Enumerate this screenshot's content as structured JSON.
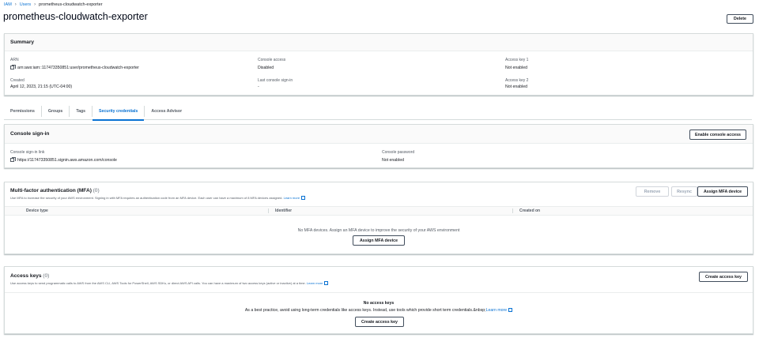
{
  "breadcrumb": {
    "root": "IAM",
    "users": "Users",
    "current": "prometheus-cloudwatch-exporter"
  },
  "page": {
    "title": "prometheus-cloudwatch-exporter",
    "delete_label": "Delete"
  },
  "summary": {
    "title": "Summary",
    "arn_label": "ARN",
    "arn_value": "arn:aws:iam::117473350851:user/prometheus-cloudwatch-exporter",
    "created_label": "Created",
    "created_value": "April 12, 2023, 21:15 (UTC-04:00)",
    "console_access_label": "Console access",
    "console_access_value": "Disabled",
    "last_signin_label": "Last console sign-in",
    "last_signin_value": "-",
    "access_key1_label": "Access key 1",
    "access_key1_value": "Not enabled",
    "access_key2_label": "Access key 2",
    "access_key2_value": "Not enabled"
  },
  "tabs": [
    "Permissions",
    "Groups",
    "Tags",
    "Security credentials",
    "Access Advisor"
  ],
  "console_signin": {
    "title": "Console sign-in",
    "enable_label": "Enable console access",
    "link_label": "Console sign-in link",
    "link_value": "https://117473350851.signin.aws.amazon.com/console",
    "password_label": "Console password",
    "password_value": "Not enabled"
  },
  "mfa": {
    "title": "Multi-factor authentication (MFA)",
    "count": "(0)",
    "description": "Use MFA to increase the security of your AWS environment. Signing in with MFA requires an authentication code from an MFA device. Each user can have a maximum of 8 MFA devices assigned.",
    "learn_more": "Learn more",
    "remove_label": "Remove",
    "resync_label": "Resync",
    "assign_label": "Assign MFA device",
    "columns": [
      "Device type",
      "Identifier",
      "Created on"
    ],
    "empty_text": "No MFA devices. Assign an MFA device to improve the security of your AWS environment",
    "empty_assign_label": "Assign MFA device"
  },
  "access_keys": {
    "title": "Access keys",
    "count": "(0)",
    "description": "Use access keys to send programmatic calls to AWS from the AWS CLI, AWS Tools for PowerShell, AWS SDKs, or direct AWS API calls. You can have a maximum of two access keys (active or inactive) at a time.",
    "learn_more": "Learn more",
    "create_label": "Create access key",
    "empty_title": "No access keys",
    "empty_text": "As a best practice, avoid using long-term credentials like access keys. Instead, use tools which provide short term credentials.&nbsp;",
    "empty_learn_more": "Learn more",
    "empty_create_label": "Create access key"
  },
  "colors": {
    "link": "#0972d3",
    "border": "#d5dbdb",
    "text": "#16191f"
  },
  "icons": [
    "copy-icon",
    "external-link-icon",
    "chevron-right-icon"
  ]
}
